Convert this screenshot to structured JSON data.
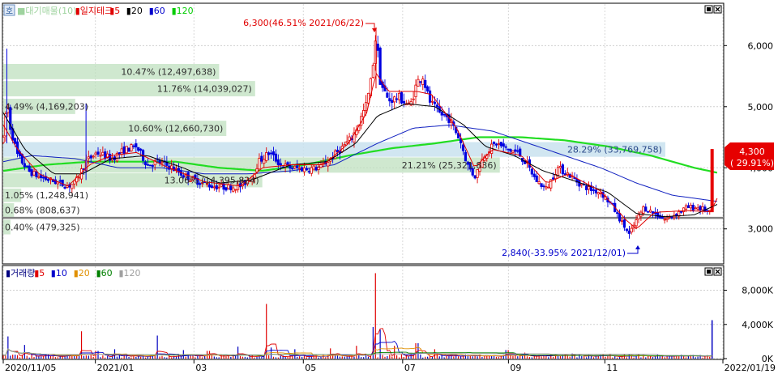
{
  "price_panel": {
    "logo_text": "호",
    "legend": [
      {
        "text": "■대기매물(10)",
        "color": "#9fd39f"
      },
      {
        "text": "▮일지테크",
        "color": "#e00000"
      },
      {
        "text": "▮5",
        "color": "#e00000"
      },
      {
        "text": "▮20",
        "color": "#000000"
      },
      {
        "text": "▮60",
        "color": "#0000cc"
      },
      {
        "text": "▮120",
        "color": "#00cc00"
      }
    ],
    "high_annotation": "6,300(46.51% 2021/06/22)",
    "low_annotation": "2,840(-33.95% 2021/12/01)",
    "current_price": "4,300",
    "current_change": "( 29.91%)",
    "support_line_value": 3180
  },
  "volume_panel": {
    "legend": [
      {
        "text": "▮거래량",
        "color": "#000080"
      },
      {
        "text": "▮5",
        "color": "#e00000"
      },
      {
        "text": "▮10",
        "color": "#0000cc"
      },
      {
        "text": "▮20",
        "color": "#e09000"
      },
      {
        "text": "▮60",
        "color": "#008000"
      },
      {
        "text": "▮120",
        "color": "#a0a0a0"
      }
    ]
  },
  "chart_data": {
    "type": "candlestick",
    "x_axis_labels": [
      {
        "label": "2020/11/05",
        "t": 0
      },
      {
        "label": "2021/01",
        "t": 0.128
      },
      {
        "label": "03",
        "t": 0.265
      },
      {
        "label": "05",
        "t": 0.417
      },
      {
        "label": "07",
        "t": 0.555
      },
      {
        "label": "09",
        "t": 0.702
      },
      {
        "label": "11",
        "t": 0.836
      },
      {
        "label": "2022/01/19",
        "t": 1.0
      }
    ],
    "price_axis": {
      "ticks": [
        "6,000",
        "5,000",
        "4,000",
        "3,000"
      ],
      "tick_values": [
        6000,
        5000,
        4000,
        3000
      ],
      "ylim": [
        2440,
        6680
      ]
    },
    "volume_axis": {
      "ticks": [
        "8,000K",
        "4,000K",
        "0K"
      ],
      "tick_values": [
        8000,
        4000,
        0
      ],
      "ylim": [
        0,
        10800
      ]
    },
    "price_series_anchors": [
      [
        0.0,
        4450
      ],
      [
        0.005,
        5100
      ],
      [
        0.01,
        4650
      ],
      [
        0.02,
        4200
      ],
      [
        0.035,
        3950
      ],
      [
        0.05,
        3850
      ],
      [
        0.07,
        3780
      ],
      [
        0.09,
        3700
      ],
      [
        0.1,
        3750
      ],
      [
        0.115,
        4100
      ],
      [
        0.13,
        4250
      ],
      [
        0.15,
        4150
      ],
      [
        0.17,
        4300
      ],
      [
        0.185,
        4350
      ],
      [
        0.2,
        4050
      ],
      [
        0.215,
        4100
      ],
      [
        0.235,
        4000
      ],
      [
        0.25,
        3880
      ],
      [
        0.27,
        3780
      ],
      [
        0.29,
        3700
      ],
      [
        0.31,
        3680
      ],
      [
        0.33,
        3700
      ],
      [
        0.345,
        3850
      ],
      [
        0.355,
        4100
      ],
      [
        0.37,
        4250
      ],
      [
        0.385,
        4050
      ],
      [
        0.4,
        4000
      ],
      [
        0.42,
        3980
      ],
      [
        0.44,
        4000
      ],
      [
        0.455,
        4150
      ],
      [
        0.47,
        4320
      ],
      [
        0.485,
        4500
      ],
      [
        0.495,
        4750
      ],
      [
        0.505,
        5050
      ],
      [
        0.512,
        5500
      ],
      [
        0.518,
        6200
      ],
      [
        0.524,
        5400
      ],
      [
        0.535,
        5100
      ],
      [
        0.55,
        5150
      ],
      [
        0.565,
        5000
      ],
      [
        0.575,
        5400
      ],
      [
        0.583,
        5500
      ],
      [
        0.592,
        5100
      ],
      [
        0.605,
        4900
      ],
      [
        0.62,
        4800
      ],
      [
        0.635,
        4450
      ],
      [
        0.645,
        4050
      ],
      [
        0.655,
        3850
      ],
      [
        0.67,
        4250
      ],
      [
        0.685,
        4400
      ],
      [
        0.7,
        4300
      ],
      [
        0.715,
        4250
      ],
      [
        0.728,
        4050
      ],
      [
        0.74,
        3800
      ],
      [
        0.755,
        3650
      ],
      [
        0.77,
        4000
      ],
      [
        0.785,
        3900
      ],
      [
        0.8,
        3750
      ],
      [
        0.815,
        3650
      ],
      [
        0.83,
        3600
      ],
      [
        0.845,
        3400
      ],
      [
        0.86,
        3100
      ],
      [
        0.87,
        2900
      ],
      [
        0.878,
        3100
      ],
      [
        0.89,
        3350
      ],
      [
        0.905,
        3250
      ],
      [
        0.92,
        3150
      ],
      [
        0.935,
        3250
      ],
      [
        0.95,
        3350
      ],
      [
        0.965,
        3350
      ],
      [
        0.975,
        3310
      ],
      [
        0.983,
        3250
      ],
      [
        0.992,
        4300
      ]
    ],
    "ma5_anchors": [
      [
        0.0,
        4700
      ],
      [
        0.02,
        4300
      ],
      [
        0.05,
        3900
      ],
      [
        0.09,
        3700
      ],
      [
        0.12,
        4050
      ],
      [
        0.15,
        4200
      ],
      [
        0.185,
        4250
      ],
      [
        0.23,
        4000
      ],
      [
        0.28,
        3770
      ],
      [
        0.33,
        3700
      ],
      [
        0.36,
        4000
      ],
      [
        0.4,
        4050
      ],
      [
        0.445,
        4050
      ],
      [
        0.48,
        4400
      ],
      [
        0.505,
        4900
      ],
      [
        0.518,
        5550
      ],
      [
        0.535,
        5250
      ],
      [
        0.575,
        5250
      ],
      [
        0.595,
        5200
      ],
      [
        0.63,
        4650
      ],
      [
        0.655,
        4000
      ],
      [
        0.68,
        4300
      ],
      [
        0.72,
        4200
      ],
      [
        0.755,
        3750
      ],
      [
        0.785,
        3900
      ],
      [
        0.83,
        3620
      ],
      [
        0.865,
        3150
      ],
      [
        0.88,
        3000
      ],
      [
        0.905,
        3270
      ],
      [
        0.95,
        3300
      ],
      [
        0.983,
        3280
      ],
      [
        0.992,
        3500
      ]
    ],
    "ma20_anchors": [
      [
        0.0,
        4900
      ],
      [
        0.03,
        4300
      ],
      [
        0.07,
        3900
      ],
      [
        0.11,
        3900
      ],
      [
        0.15,
        4150
      ],
      [
        0.2,
        4200
      ],
      [
        0.25,
        4000
      ],
      [
        0.3,
        3750
      ],
      [
        0.345,
        3800
      ],
      [
        0.4,
        4050
      ],
      [
        0.45,
        4100
      ],
      [
        0.49,
        4400
      ],
      [
        0.52,
        4850
      ],
      [
        0.56,
        5050
      ],
      [
        0.6,
        5000
      ],
      [
        0.64,
        4700
      ],
      [
        0.67,
        4350
      ],
      [
        0.71,
        4200
      ],
      [
        0.75,
        3950
      ],
      [
        0.79,
        3800
      ],
      [
        0.84,
        3600
      ],
      [
        0.88,
        3250
      ],
      [
        0.92,
        3200
      ],
      [
        0.96,
        3230
      ],
      [
        0.992,
        3400
      ]
    ],
    "ma60_anchors": [
      [
        0.0,
        4100
      ],
      [
        0.04,
        4200
      ],
      [
        0.1,
        4150
      ],
      [
        0.16,
        4000
      ],
      [
        0.22,
        4000
      ],
      [
        0.28,
        3900
      ],
      [
        0.34,
        3900
      ],
      [
        0.4,
        3950
      ],
      [
        0.46,
        4050
      ],
      [
        0.52,
        4400
      ],
      [
        0.57,
        4650
      ],
      [
        0.62,
        4700
      ],
      [
        0.68,
        4600
      ],
      [
        0.73,
        4400
      ],
      [
        0.78,
        4200
      ],
      [
        0.83,
        4000
      ],
      [
        0.88,
        3750
      ],
      [
        0.93,
        3550
      ],
      [
        0.992,
        3450
      ]
    ],
    "ma120_anchors": [
      [
        0.0,
        3950
      ],
      [
        0.06,
        4050
      ],
      [
        0.12,
        4100
      ],
      [
        0.18,
        4100
      ],
      [
        0.24,
        4100
      ],
      [
        0.3,
        4000
      ],
      [
        0.36,
        3950
      ],
      [
        0.42,
        4050
      ],
      [
        0.48,
        4200
      ],
      [
        0.54,
        4320
      ],
      [
        0.6,
        4400
      ],
      [
        0.66,
        4500
      ],
      [
        0.72,
        4500
      ],
      [
        0.78,
        4450
      ],
      [
        0.84,
        4350
      ],
      [
        0.9,
        4200
      ],
      [
        0.96,
        4000
      ],
      [
        0.992,
        3920
      ]
    ],
    "resistance_bands": [
      {
        "label": "10.47% (12,497,638)",
        "y_low": 5450,
        "y_high": 5700,
        "value_fraction": 0.3
      },
      {
        "label": "11.76% (14,039,027)",
        "y_low": 5170,
        "y_high": 5420,
        "value_fraction": 0.35
      },
      {
        "label": "4.49% (4,169,203)",
        "y_low": 4880,
        "y_high": 5130,
        "value_fraction": 0.1
      },
      {
        "label": "10.60% (12,660,730)",
        "y_low": 4520,
        "y_high": 4770,
        "value_fraction": 0.31
      },
      {
        "label": "28.29% (33,769,758)",
        "y_low": 4180,
        "y_high": 4420,
        "value_fraction": 0.92
      },
      {
        "label": "21.21% (25,321,836)",
        "y_low": 3920,
        "y_high": 4170,
        "value_fraction": 0.69
      },
      {
        "label": "13.06% (14,395,824)",
        "y_low": 3680,
        "y_high": 3910,
        "value_fraction": 0.36
      },
      {
        "label": "1.05% (1,248,941)",
        "y_low": 3440,
        "y_high": 3660,
        "value_fraction": 0.025
      },
      {
        "label": "0.68% (808,637)",
        "y_low": 3190,
        "y_high": 3420,
        "value_fraction": 0.015
      },
      {
        "label": "0.40% (479,325)",
        "y_low": 2910,
        "y_high": 3150,
        "value_fraction": 0.01
      }
    ],
    "volume_spikes": [
      [
        0.006,
        2600
      ],
      [
        0.03,
        1600
      ],
      [
        0.108,
        3200
      ],
      [
        0.13,
        900
      ],
      [
        0.155,
        1100
      ],
      [
        0.215,
        2700
      ],
      [
        0.25,
        1000
      ],
      [
        0.285,
        900
      ],
      [
        0.325,
        1400
      ],
      [
        0.365,
        6400
      ],
      [
        0.372,
        1300
      ],
      [
        0.405,
        1100
      ],
      [
        0.455,
        1200
      ],
      [
        0.49,
        1500
      ],
      [
        0.515,
        3700
      ],
      [
        0.518,
        10000
      ],
      [
        0.524,
        3400
      ],
      [
        0.545,
        1500
      ],
      [
        0.575,
        1800
      ],
      [
        0.6,
        1100
      ],
      [
        0.7,
        1000
      ],
      [
        0.725,
        700
      ],
      [
        0.79,
        600
      ],
      [
        0.87,
        500
      ],
      [
        0.992,
        4500
      ]
    ]
  }
}
